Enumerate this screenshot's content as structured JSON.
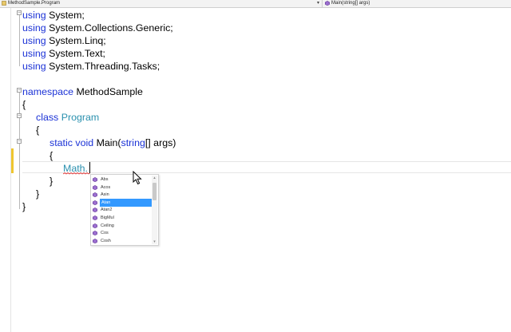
{
  "navbar": {
    "left_text": "MethodSample.Program",
    "right_text": "Main(string[] args)",
    "dropdown_glyph": "▾"
  },
  "code": {
    "usings": [
      {
        "kw": "using",
        "name": "System;"
      },
      {
        "kw": "using",
        "name": "System.Collections.Generic;"
      },
      {
        "kw": "using",
        "name": "System.Linq;"
      },
      {
        "kw": "using",
        "name": "System.Text;"
      },
      {
        "kw": "using",
        "name": "System.Threading.Tasks;"
      }
    ],
    "namespace_kw": "namespace",
    "namespace_name": "MethodSample",
    "open_brace": "{",
    "close_brace": "}",
    "class_kw": "class",
    "class_name": "Program",
    "method_static": "static",
    "method_void": "void",
    "method_name": "Main(",
    "param_type": "string",
    "param_rest": "[] args)",
    "typed_text": "Math."
  },
  "completion": {
    "items": [
      "Abs",
      "Acos",
      "Asin",
      "Atan",
      "Atan2",
      "BigMul",
      "Ceiling",
      "Cos",
      "Cosh"
    ],
    "selected_index": 3,
    "item_icon": "method-icon"
  },
  "colors": {
    "keyword": "#1b32d6",
    "type": "#2b91af",
    "selection": "#3399ff",
    "change_marker": "#efc630"
  }
}
